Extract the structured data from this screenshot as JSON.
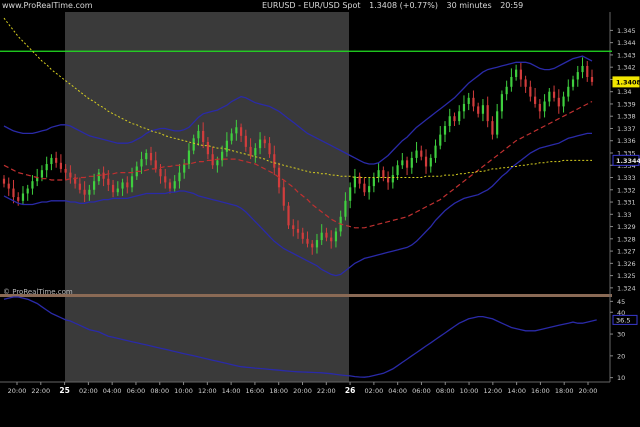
{
  "header": {
    "brand": "www.ProRealTime.com",
    "symbol": "EURUSD - EUR/USD Spot",
    "last": "1.3408 (+0.77%)",
    "interval": "30 minutes",
    "time": "20:59"
  },
  "watermark": "© ProRealTime.com",
  "colors": {
    "background": "#000000",
    "session_shade": "#3a3a3a",
    "bull_candle": "#3fcf3f",
    "bear_candle": "#d23c3c",
    "bollinger": "#2a2aa8",
    "ma_dashed": "#c03030",
    "ma_dotted": "#d8d020",
    "resistance_line": "#22e022"
  },
  "chart_data": [
    {
      "type": "candlestick",
      "ylim": [
        1.3235,
        1.3465
      ],
      "yticks": [
        "1.324",
        "1.325",
        "1.326",
        "1.327",
        "1.328",
        "1.329",
        "1.33",
        "1.331",
        "1.332",
        "1.333",
        "1.334",
        "1.335",
        "1.336",
        "1.337",
        "1.338",
        "1.339",
        "1.34",
        "1.341",
        "1.342",
        "1.343",
        "1.344",
        "1.345"
      ],
      "xticks": [
        "20:00",
        "22:00",
        "25",
        "02:00",
        "04:00",
        "06:00",
        "08:00",
        "10:00",
        "12:00",
        "14:00",
        "16:00",
        "18:00",
        "20:00",
        "22:00",
        "26",
        "02:00",
        "04:00",
        "06:00",
        "08:00",
        "10:00",
        "12:00",
        "14:00",
        "16:00",
        "18:00",
        "20:00"
      ],
      "price_labels": [
        {
          "text": "1.3408",
          "value": 1.3408,
          "style": "yellow"
        },
        {
          "text": "1.3344",
          "value": 1.3344,
          "style": "blue"
        }
      ],
      "horizontal_line": 1.3433,
      "close": [
        1.3325,
        1.3321,
        1.3314,
        1.3311,
        1.3317,
        1.3321,
        1.3327,
        1.333,
        1.3336,
        1.3341,
        1.3346,
        1.3342,
        1.3337,
        1.3334,
        1.333,
        1.3325,
        1.332,
        1.3316,
        1.332,
        1.3327,
        1.3334,
        1.3329,
        1.3324,
        1.3318,
        1.3321,
        1.3326,
        1.3322,
        1.3331,
        1.3339,
        1.3345,
        1.335,
        1.3344,
        1.3337,
        1.3331,
        1.3326,
        1.3321,
        1.3327,
        1.3334,
        1.3341,
        1.3352,
        1.3362,
        1.3368,
        1.3359,
        1.3349,
        1.334,
        1.3344,
        1.3351,
        1.336,
        1.3366,
        1.3371,
        1.3364,
        1.3355,
        1.3348,
        1.3354,
        1.3361,
        1.3358,
        1.3349,
        1.3338,
        1.3322,
        1.3307,
        1.3291,
        1.3288,
        1.3285,
        1.328,
        1.3276,
        1.3273,
        1.3279,
        1.3285,
        1.3281,
        1.3278,
        1.3286,
        1.3298,
        1.3311,
        1.3322,
        1.3331,
        1.3325,
        1.3318,
        1.3323,
        1.333,
        1.3336,
        1.333,
        1.3326,
        1.3332,
        1.334,
        1.3344,
        1.3338,
        1.3346,
        1.3352,
        1.3347,
        1.3339,
        1.3346,
        1.3356,
        1.3365,
        1.3372,
        1.338,
        1.3376,
        1.3384,
        1.339,
        1.3395,
        1.3388,
        1.3382,
        1.3389,
        1.3376,
        1.3365,
        1.3384,
        1.3398,
        1.3404,
        1.3412,
        1.3418,
        1.341,
        1.3404,
        1.3396,
        1.339,
        1.3384,
        1.3392,
        1.34,
        1.3395,
        1.3388,
        1.3396,
        1.3404,
        1.341,
        1.3416,
        1.3421,
        1.3412,
        1.3408
      ],
      "bollinger_upper": [
        1.3372,
        1.337,
        1.3368,
        1.3367,
        1.3366,
        1.3366,
        1.3366,
        1.3367,
        1.3368,
        1.3369,
        1.3371,
        1.3372,
        1.3373,
        1.3373,
        1.3372,
        1.337,
        1.3368,
        1.3366,
        1.3364,
        1.3363,
        1.3362,
        1.3361,
        1.336,
        1.3359,
        1.3358,
        1.3358,
        1.3358,
        1.3359,
        1.3361,
        1.3363,
        1.3366,
        1.3368,
        1.3369,
        1.337,
        1.337,
        1.3369,
        1.3368,
        1.3368,
        1.3369,
        1.3371,
        1.3375,
        1.3379,
        1.3382,
        1.3383,
        1.3384,
        1.3385,
        1.3387,
        1.3389,
        1.3392,
        1.3394,
        1.3396,
        1.3395,
        1.3393,
        1.3391,
        1.339,
        1.3389,
        1.3388,
        1.3386,
        1.3384,
        1.3381,
        1.3378,
        1.3375,
        1.3372,
        1.3369,
        1.3366,
        1.3364,
        1.3362,
        1.336,
        1.3358,
        1.3356,
        1.3354,
        1.3352,
        1.335,
        1.3348,
        1.3346,
        1.3344,
        1.3342,
        1.3341,
        1.3341,
        1.3342,
        1.3345,
        1.3348,
        1.3352,
        1.3356,
        1.336,
        1.3363,
        1.3367,
        1.3371,
        1.3374,
        1.3377,
        1.338,
        1.3383,
        1.3386,
        1.3389,
        1.3392,
        1.3395,
        1.3399,
        1.3403,
        1.3407,
        1.341,
        1.3413,
        1.3416,
        1.3418,
        1.3419,
        1.342,
        1.3421,
        1.3422,
        1.3423,
        1.3424,
        1.3424,
        1.3424,
        1.3423,
        1.3421,
        1.3419,
        1.3418,
        1.3418,
        1.3419,
        1.3421,
        1.3423,
        1.3425,
        1.3427,
        1.3428,
        1.3429,
        1.3427,
        1.3425
      ],
      "bollinger_lower": [
        1.3315,
        1.3313,
        1.3311,
        1.3309,
        1.3308,
        1.3308,
        1.3308,
        1.3309,
        1.331,
        1.331,
        1.3311,
        1.3311,
        1.3311,
        1.3311,
        1.331,
        1.331,
        1.3309,
        1.3309,
        1.331,
        1.331,
        1.3311,
        1.3312,
        1.3312,
        1.3313,
        1.3313,
        1.3313,
        1.3313,
        1.3314,
        1.3315,
        1.3316,
        1.3317,
        1.3317,
        1.3317,
        1.3317,
        1.3317,
        1.3318,
        1.3318,
        1.3319,
        1.3319,
        1.3318,
        1.3317,
        1.3315,
        1.3314,
        1.3313,
        1.3312,
        1.3311,
        1.331,
        1.3309,
        1.3308,
        1.3307,
        1.3305,
        1.3302,
        1.3298,
        1.3294,
        1.329,
        1.3286,
        1.3282,
        1.3278,
        1.3275,
        1.3272,
        1.327,
        1.3268,
        1.3266,
        1.3264,
        1.3262,
        1.326,
        1.3258,
        1.3255,
        1.3253,
        1.3251,
        1.325,
        1.3251,
        1.3254,
        1.3257,
        1.326,
        1.3262,
        1.3264,
        1.3265,
        1.3266,
        1.3267,
        1.3268,
        1.3269,
        1.327,
        1.3271,
        1.3272,
        1.3273,
        1.3275,
        1.3278,
        1.3282,
        1.3286,
        1.329,
        1.3295,
        1.3299,
        1.3303,
        1.3306,
        1.3309,
        1.3311,
        1.3313,
        1.3314,
        1.3315,
        1.3316,
        1.3318,
        1.332,
        1.3323,
        1.3327,
        1.3331,
        1.3334,
        1.3338,
        1.3341,
        1.3344,
        1.3347,
        1.335,
        1.3352,
        1.3354,
        1.3355,
        1.3356,
        1.3357,
        1.3358,
        1.336,
        1.3362,
        1.3363,
        1.3364,
        1.3365,
        1.3366,
        1.3366
      ],
      "ma_dashed": [
        1.334,
        1.3338,
        1.3336,
        1.3334,
        1.3333,
        1.3332,
        1.3331,
        1.333,
        1.3329,
        1.3329,
        1.3328,
        1.3328,
        1.3328,
        1.3328,
        1.3329,
        1.3329,
        1.333,
        1.333,
        1.3331,
        1.3331,
        1.3332,
        1.3332,
        1.3333,
        1.3333,
        1.3334,
        1.3334,
        1.3334,
        1.3334,
        1.3335,
        1.3335,
        1.3336,
        1.3337,
        1.3337,
        1.3338,
        1.3339,
        1.3339,
        1.334,
        1.334,
        1.3341,
        1.3341,
        1.3342,
        1.3343,
        1.3343,
        1.3344,
        1.3344,
        1.3345,
        1.3345,
        1.3345,
        1.3345,
        1.3345,
        1.3344,
        1.3343,
        1.3342,
        1.3341,
        1.3339,
        1.3337,
        1.3335,
        1.3333,
        1.333,
        1.3328,
        1.3325,
        1.3322,
        1.3318,
        1.3315,
        1.3312,
        1.3308,
        1.3305,
        1.3302,
        1.3299,
        1.3296,
        1.3294,
        1.3292,
        1.3291,
        1.329,
        1.3289,
        1.3289,
        1.3289,
        1.329,
        1.3291,
        1.3292,
        1.3293,
        1.3294,
        1.3295,
        1.3296,
        1.3297,
        1.3298,
        1.33,
        1.3302,
        1.3304,
        1.3306,
        1.3308,
        1.331,
        1.3312,
        1.3315,
        1.3318,
        1.3321,
        1.3324,
        1.3327,
        1.333,
        1.3333,
        1.3336,
        1.3339,
        1.3342,
        1.3345,
        1.3348,
        1.3351,
        1.3354,
        1.3357,
        1.336,
        1.3362,
        1.3364,
        1.3366,
        1.3368,
        1.337,
        1.3372,
        1.3374,
        1.3376,
        1.3378,
        1.338,
        1.3382,
        1.3384,
        1.3386,
        1.3388,
        1.339,
        1.3392
      ],
      "ma_dotted": [
        1.346,
        1.3455,
        1.345,
        1.3445,
        1.3441,
        1.3437,
        1.3433,
        1.3429,
        1.3425,
        1.3422,
        1.3418,
        1.3415,
        1.3412,
        1.3409,
        1.3406,
        1.3403,
        1.34,
        1.3397,
        1.3394,
        1.3392,
        1.3389,
        1.3387,
        1.3384,
        1.3382,
        1.338,
        1.3378,
        1.3376,
        1.3374,
        1.3373,
        1.3371,
        1.337,
        1.3368,
        1.3367,
        1.3366,
        1.3364,
        1.3363,
        1.3362,
        1.3361,
        1.336,
        1.3359,
        1.3358,
        1.3357,
        1.3356,
        1.3356,
        1.3355,
        1.3354,
        1.3354,
        1.3353,
        1.3352,
        1.3351,
        1.335,
        1.3349,
        1.3348,
        1.3347,
        1.3346,
        1.3345,
        1.3343,
        1.3342,
        1.3341,
        1.334,
        1.3339,
        1.3338,
        1.3337,
        1.3336,
        1.3335,
        1.3334,
        1.3334,
        1.3333,
        1.3333,
        1.3332,
        1.3332,
        1.3331,
        1.3331,
        1.3331,
        1.333,
        1.333,
        1.333,
        1.333,
        1.333,
        1.333,
        1.333,
        1.333,
        1.333,
        1.333,
        1.333,
        1.333,
        1.333,
        1.333,
        1.333,
        1.3331,
        1.3331,
        1.3331,
        1.3331,
        1.3332,
        1.3332,
        1.3332,
        1.3333,
        1.3333,
        1.3334,
        1.3334,
        1.3335,
        1.3335,
        1.3336,
        1.3337,
        1.3337,
        1.3338,
        1.3338,
        1.3339,
        1.3339,
        1.334,
        1.334,
        1.3341,
        1.3341,
        1.3342,
        1.3342,
        1.3343,
        1.3343,
        1.3343,
        1.3344,
        1.3344,
        1.3344,
        1.3344,
        1.3344,
        1.3344,
        1.3344
      ]
    },
    {
      "type": "line",
      "ylim": [
        8,
        47
      ],
      "yticks": [
        "10",
        "20",
        "30",
        "40",
        "45"
      ],
      "price_labels": [
        {
          "text": "36.5",
          "value": 36.5,
          "style": "blue"
        }
      ],
      "values": [
        46.0,
        46.5,
        47.0,
        47.0,
        46.5,
        46.0,
        45.0,
        44.0,
        42.5,
        41.0,
        39.5,
        38.5,
        37.5,
        36.5,
        36.0,
        35.0,
        34.0,
        33.0,
        32.0,
        31.5,
        31.0,
        30.0,
        29.0,
        28.5,
        28.0,
        27.5,
        27.0,
        26.5,
        26.0,
        25.5,
        25.0,
        24.5,
        24.0,
        23.5,
        23.0,
        22.5,
        22.0,
        21.5,
        21.0,
        20.5,
        20.0,
        19.5,
        19.0,
        18.5,
        18.0,
        17.5,
        17.0,
        16.5,
        16.0,
        15.5,
        15.0,
        14.8,
        14.6,
        14.4,
        14.2,
        14.0,
        13.8,
        13.6,
        13.4,
        13.2,
        13.0,
        12.8,
        12.7,
        12.6,
        12.5,
        12.4,
        12.3,
        12.2,
        12.0,
        11.8,
        11.5,
        11.2,
        11.0,
        10.8,
        10.5,
        10.3,
        10.2,
        10.5,
        11.0,
        11.5,
        12.0,
        13.0,
        14.0,
        15.5,
        17.0,
        18.5,
        20.0,
        21.5,
        23.0,
        24.5,
        26.0,
        27.5,
        29.0,
        30.5,
        32.0,
        33.5,
        35.0,
        36.0,
        37.0,
        37.5,
        38.0,
        38.0,
        37.5,
        37.0,
        36.0,
        35.0,
        34.0,
        33.0,
        32.5,
        32.0,
        31.5,
        31.5,
        31.5,
        32.0,
        32.5,
        33.0,
        33.5,
        34.0,
        34.5,
        35.0,
        35.5,
        35.0,
        35.0,
        35.5,
        36.0,
        36.5
      ]
    }
  ]
}
